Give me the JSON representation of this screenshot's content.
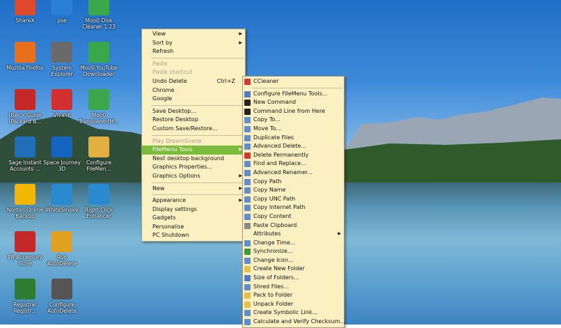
{
  "desktop_icons": [
    {
      "label": "ShareX",
      "color": "#e04a2a"
    },
    {
      "label": "pse",
      "color": "#2a7fd6"
    },
    {
      "label": "Moo0 Disk Cleaner 1.23",
      "color": "#3aa84a"
    },
    {
      "label": "Mozilla Firefox",
      "color": "#e8701a"
    },
    {
      "label": "System Explorer",
      "color": "#6a6a6a"
    },
    {
      "label": "Moo0 YouTube Downloader",
      "color": "#3aa84a"
    },
    {
      "label": "User's Guide (Packard B...",
      "color": "#c62828"
    },
    {
      "label": "Vivaldi",
      "color": "#d32f2f"
    },
    {
      "label": "Moo0 TransparentM...",
      "color": "#3aa84a"
    },
    {
      "label": "Sage Instant Accounts ...",
      "color": "#1e6fb8"
    },
    {
      "label": "Space Journey 3D",
      "color": "#1565c0"
    },
    {
      "label": "Configure FileMen...",
      "color": "#e0b040"
    },
    {
      "label": "Norton Online Backup",
      "color": "#f2b705"
    },
    {
      "label": "WhiteSmoke",
      "color": "#2a8ad0"
    },
    {
      "label": "Right Click Enhancer",
      "color": "#2a8ad0"
    },
    {
      "label": "PB Accessory Store",
      "color": "#c62828"
    },
    {
      "label": "Run AutoDelete",
      "color": "#e0a020"
    },
    {
      "label": "Registrar Registr...",
      "color": "#2e7d32"
    },
    {
      "label": "Configure AutoDelete",
      "color": "#555555"
    }
  ],
  "context_menu": {
    "items": [
      {
        "label": "View",
        "arrow": "▶"
      },
      {
        "label": "Sort by",
        "arrow": "▶"
      },
      {
        "label": "Refresh"
      },
      {
        "sep": true
      },
      {
        "label": "Paste",
        "disabled": true
      },
      {
        "label": "Paste shortcut",
        "disabled": true
      },
      {
        "label": "Undo Delete",
        "shortcut": "Ctrl+Z"
      },
      {
        "label": "Chrome"
      },
      {
        "label": "Google"
      },
      {
        "sep": true
      },
      {
        "label": "Save Desktop..."
      },
      {
        "label": "Restore Desktop"
      },
      {
        "label": "Custom Save/Restore..."
      },
      {
        "sep": true
      },
      {
        "label": "Play DreamScene",
        "disabled": true
      },
      {
        "label": "FileMenu Tools",
        "arrow": "▶",
        "highlighted": true
      },
      {
        "label": "Next desktop background"
      },
      {
        "label": "Graphics Properties..."
      },
      {
        "label": "Graphics Options",
        "arrow": "▶"
      },
      {
        "sep": true
      },
      {
        "label": "New",
        "arrow": "▶"
      },
      {
        "sep": true
      },
      {
        "label": "Appearance",
        "arrow": "▶"
      },
      {
        "label": "Display settings"
      },
      {
        "label": "Gadgets"
      },
      {
        "label": "Personalise"
      },
      {
        "label": "PC Shutdown"
      }
    ]
  },
  "submenu": {
    "items": [
      {
        "label": "CCleaner",
        "icon_color": "#d33"
      },
      {
        "sep": true
      },
      {
        "label": "Configure FileMenu Tools...",
        "icon_color": "#4a7bd1"
      },
      {
        "label": "New Command",
        "icon_color": "#222"
      },
      {
        "label": "Command Line from Here",
        "icon_color": "#222"
      },
      {
        "label": "Copy To...",
        "icon_color": "#5a8fd8"
      },
      {
        "label": "Move To...",
        "icon_color": "#5a8fd8"
      },
      {
        "label": "Duplicate Files",
        "icon_color": "#5a8fd8"
      },
      {
        "label": "Advanced Delete...",
        "icon_color": "#5a8fd8"
      },
      {
        "label": "Delete Permanently",
        "icon_color": "#d33"
      },
      {
        "label": "Find and Replace...",
        "icon_color": "#5a8fd8"
      },
      {
        "label": "Advanced Renamer...",
        "icon_color": "#5a8fd8"
      },
      {
        "label": "Copy Path",
        "icon_color": "#5a8fd8"
      },
      {
        "label": "Copy Name",
        "icon_color": "#5a8fd8"
      },
      {
        "label": "Copy UNC Path",
        "icon_color": "#5a8fd8"
      },
      {
        "label": "Copy Internet Path",
        "icon_color": "#5a8fd8"
      },
      {
        "label": "Copy Content",
        "icon_color": "#5a8fd8"
      },
      {
        "label": "Paste Clipboard",
        "icon_color": "#888"
      },
      {
        "label": "Attributes",
        "arrow": "▶",
        "icon_color": ""
      },
      {
        "label": "Change Time...",
        "icon_color": "#5a8fd8"
      },
      {
        "label": "Synchronize...",
        "icon_color": "#3a9a3a"
      },
      {
        "label": "Change Icon...",
        "icon_color": "#5a8fd8"
      },
      {
        "label": "Create New Folder",
        "icon_color": "#e8c040"
      },
      {
        "label": "Size of Folders...",
        "icon_color": "#4a7bd1"
      },
      {
        "label": "Shred Files...",
        "icon_color": "#5a8fd8"
      },
      {
        "label": "Pack to Folder",
        "icon_color": "#e8c040"
      },
      {
        "label": "Unpack Folder",
        "icon_color": "#e8c040"
      },
      {
        "label": "Create Symbolic Link...",
        "icon_color": "#5a8fd8"
      },
      {
        "label": "Calculate and Verify Checksum...",
        "icon_color": "#5a8fd8"
      }
    ]
  }
}
